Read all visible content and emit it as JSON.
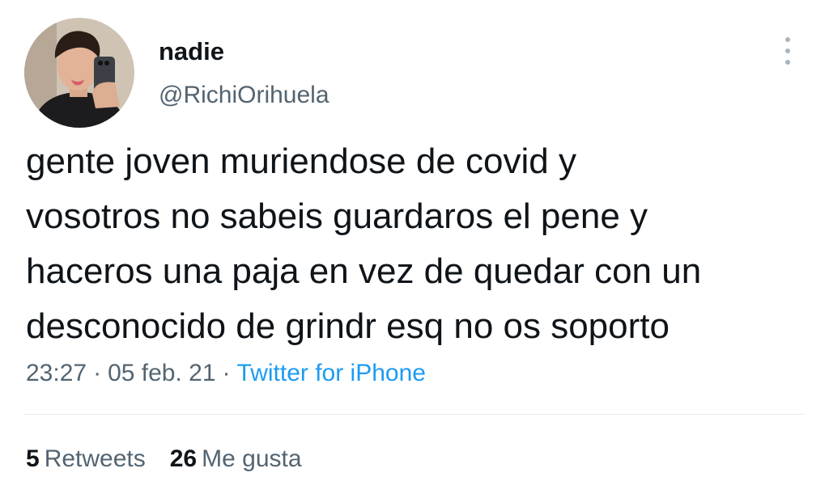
{
  "author": {
    "display_name": "nadie",
    "handle": "@RichiOrihuela",
    "avatar_icon": "profile-photo-icon"
  },
  "tweet": {
    "lines": [
      "gente joven muriendose de covid y",
      "vosotros no sabeis guardaros el pene y",
      "haceros una paja en vez de quedar con un",
      "desconocido de grindr esq no os soporto"
    ]
  },
  "meta": {
    "time": "23:27",
    "separator": "·",
    "date": "05 feb. 21",
    "source": "Twitter for iPhone"
  },
  "stats": {
    "retweets_count": "5",
    "retweets_label": "Retweets",
    "likes_count": "26",
    "likes_label": "Me gusta"
  },
  "colors": {
    "text": "#0f1419",
    "secondary": "#536471",
    "link": "#1d9bf0",
    "divider": "#e6ecf0"
  },
  "icons": {
    "more": "more-vertical-icon"
  }
}
